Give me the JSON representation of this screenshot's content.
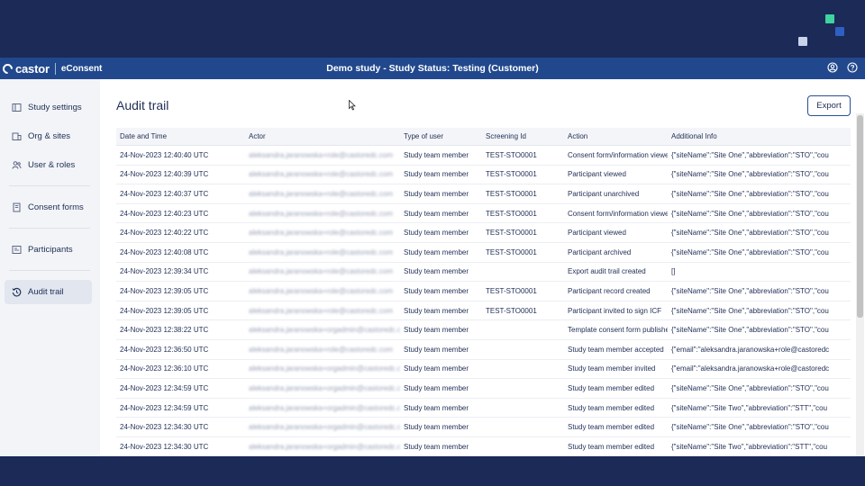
{
  "header": {
    "logo": "castor",
    "product": "eConsent",
    "study_title": "Demo study  - Study Status: Testing (Customer)"
  },
  "icons": {
    "account": "user-circle-icon",
    "help": "help-circle-icon"
  },
  "sidebar": {
    "items": [
      {
        "label": "Study settings",
        "icon": "settings-icon"
      },
      {
        "label": "Org & sites",
        "icon": "org-icon"
      },
      {
        "label": "User & roles",
        "icon": "users-icon"
      },
      {
        "label": "Consent forms",
        "icon": "document-icon"
      },
      {
        "label": "Participants",
        "icon": "participants-icon"
      },
      {
        "label": "Audit trail",
        "icon": "history-icon",
        "active": true
      }
    ]
  },
  "main": {
    "title": "Audit trail",
    "export_label": "Export"
  },
  "table": {
    "columns": [
      "Date and Time",
      "Actor",
      "Type of user",
      "Screening Id",
      "Action",
      "Additional Info"
    ],
    "rows": [
      [
        "24-Nov-2023 12:40:40 UTC",
        "aleksandra.jaranowska+role@castoredc.com",
        "Study team member",
        "TEST-STO0001",
        "Consent form/information viewed",
        "{\"siteName\":\"Site One\",\"abbreviation\":\"STO\",\"cou"
      ],
      [
        "24-Nov-2023 12:40:39 UTC",
        "aleksandra.jaranowska+role@castoredc.com",
        "Study team member",
        "TEST-STO0001",
        "Participant viewed",
        "{\"siteName\":\"Site One\",\"abbreviation\":\"STO\",\"cou"
      ],
      [
        "24-Nov-2023 12:40:37 UTC",
        "aleksandra.jaranowska+role@castoredc.com",
        "Study team member",
        "TEST-STO0001",
        "Participant unarchived",
        "{\"siteName\":\"Site One\",\"abbreviation\":\"STO\",\"cou"
      ],
      [
        "24-Nov-2023 12:40:23 UTC",
        "aleksandra.jaranowska+role@castoredc.com",
        "Study team member",
        "TEST-STO0001",
        "Consent form/information viewed",
        "{\"siteName\":\"Site One\",\"abbreviation\":\"STO\",\"cou"
      ],
      [
        "24-Nov-2023 12:40:22 UTC",
        "aleksandra.jaranowska+role@castoredc.com",
        "Study team member",
        "TEST-STO0001",
        "Participant viewed",
        "{\"siteName\":\"Site One\",\"abbreviation\":\"STO\",\"cou"
      ],
      [
        "24-Nov-2023 12:40:08 UTC",
        "aleksandra.jaranowska+role@castoredc.com",
        "Study team member",
        "TEST-STO0001",
        "Participant archived",
        "{\"siteName\":\"Site One\",\"abbreviation\":\"STO\",\"cou"
      ],
      [
        "24-Nov-2023 12:39:34 UTC",
        "aleksandra.jaranowska+role@castoredc.com",
        "Study team member",
        "",
        "Export audit trail created",
        "[]"
      ],
      [
        "24-Nov-2023 12:39:05 UTC",
        "aleksandra.jaranowska+role@castoredc.com",
        "Study team member",
        "TEST-STO0001",
        "Participant record created",
        "{\"siteName\":\"Site One\",\"abbreviation\":\"STO\",\"cou"
      ],
      [
        "24-Nov-2023 12:39:05 UTC",
        "aleksandra.jaranowska+role@castoredc.com",
        "Study team member",
        "TEST-STO0001",
        "Participant invited to sign ICF",
        "{\"siteName\":\"Site One\",\"abbreviation\":\"STO\",\"cou"
      ],
      [
        "24-Nov-2023 12:38:22 UTC",
        "aleksandra.jaranowska+orgadmin@castoredc.com",
        "Study team member",
        "",
        "Template consent form published",
        "{\"siteName\":\"Site One\",\"abbreviation\":\"STO\",\"cou"
      ],
      [
        "24-Nov-2023 12:36:50 UTC",
        "aleksandra.jaranowska+role@castoredc.com",
        "Study team member",
        "",
        "Study team member accepted",
        "{\"email\":\"aleksandra.jaranowska+role@castoredc"
      ],
      [
        "24-Nov-2023 12:36:10 UTC",
        "aleksandra.jaranowska+orgadmin@castoredc.com",
        "Study team member",
        "",
        "Study team member invited",
        "{\"email\":\"aleksandra.jaranowska+role@castoredc"
      ],
      [
        "24-Nov-2023 12:34:59 UTC",
        "aleksandra.jaranowska+orgadmin@castoredc.com",
        "Study team member",
        "",
        "Study team member edited",
        "{\"siteName\":\"Site One\",\"abbreviation\":\"STO\",\"cou"
      ],
      [
        "24-Nov-2023 12:34:59 UTC",
        "aleksandra.jaranowska+orgadmin@castoredc.com",
        "Study team member",
        "",
        "Study team member edited",
        "{\"siteName\":\"Site Two\",\"abbreviation\":\"STT\",\"cou"
      ],
      [
        "24-Nov-2023 12:34:30 UTC",
        "aleksandra.jaranowska+orgadmin@castoredc.com",
        "Study team member",
        "",
        "Study team member edited",
        "{\"siteName\":\"Site One\",\"abbreviation\":\"STO\",\"cou"
      ],
      [
        "24-Nov-2023 12:34:30 UTC",
        "aleksandra.jaranowska+orgadmin@castoredc.com",
        "Study team member",
        "",
        "Study team member edited",
        "{\"siteName\":\"Site Two\",\"abbreviation\":\"STT\",\"cou"
      ]
    ]
  }
}
